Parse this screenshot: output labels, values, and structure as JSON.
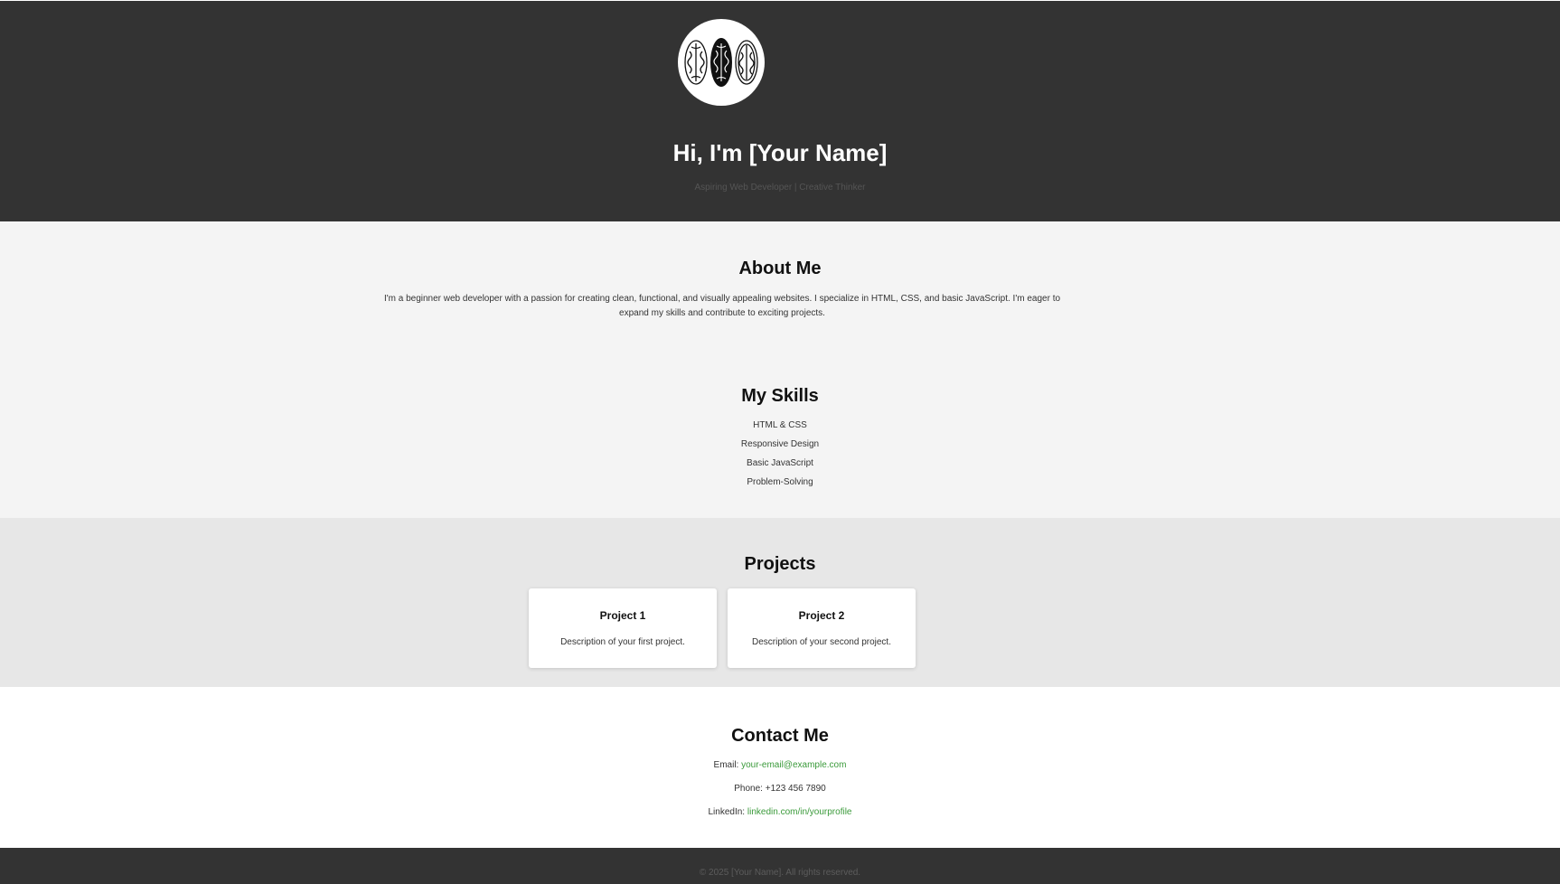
{
  "hero": {
    "avatar_icon": "brain-triptych-icon",
    "title": "Hi, I'm [Your Name]",
    "subtitle": "Aspiring Web Developer | Creative Thinker"
  },
  "about": {
    "heading": "About Me",
    "text": "I'm a beginner web developer with a passion for creating clean, functional, and visually appealing websites. I specialize in HTML, CSS, and basic JavaScript. I'm eager to expand my skills and contribute to exciting projects."
  },
  "skills": {
    "heading": "My Skills",
    "items": [
      "HTML & CSS",
      "Responsive Design",
      "Basic JavaScript",
      "Problem-Solving"
    ]
  },
  "projects": {
    "heading": "Projects",
    "items": [
      {
        "title": "Project 1",
        "description": "Description of your first project."
      },
      {
        "title": "Project 2",
        "description": "Description of your second project."
      }
    ]
  },
  "contact": {
    "heading": "Contact Me",
    "email_label": "Email:",
    "email_value": "your-email@example.com",
    "phone_label": "Phone:",
    "phone_value": "+123 456 7890",
    "linkedin_label": "LinkedIn:",
    "linkedin_value": "linkedin.com/in/yourprofile"
  },
  "footer": {
    "text": "© 2025 [Your Name]. All rights reserved."
  },
  "colors": {
    "header_bg": "#333333",
    "light_bg": "#f4f4f4",
    "projects_bg": "#e7e7e7",
    "link": "#3a9a3a"
  }
}
